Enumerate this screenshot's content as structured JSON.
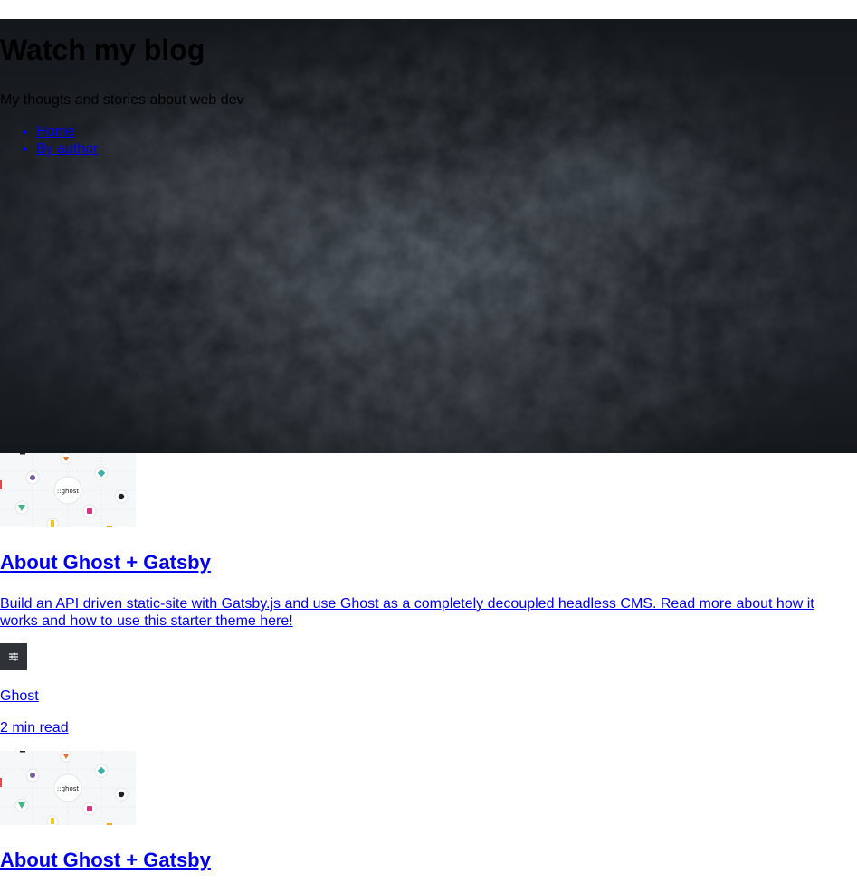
{
  "site": {
    "title": "Watch my blog",
    "description": "My thougts and stories about web dev",
    "nav": [
      {
        "label": "Home"
      },
      {
        "label": "By author"
      }
    ]
  },
  "posts": [
    {
      "title": "About Ghost + Gatsby",
      "excerpt": "Build an API driven static-site with Gatsby.js and use Ghost as a completely decoupled headless CMS. Read more about how it works and how to use this starter theme here!",
      "tag": "Ghost",
      "reading_time": "2 min read",
      "image_logo_text": "::ghost"
    },
    {
      "title": "About Ghost + Gatsby",
      "image_logo_text": "::ghost"
    }
  ],
  "colors": {
    "link": "#0000ee",
    "hero_bg": "#1c2026",
    "filter_button_bg": "#2f3338"
  }
}
